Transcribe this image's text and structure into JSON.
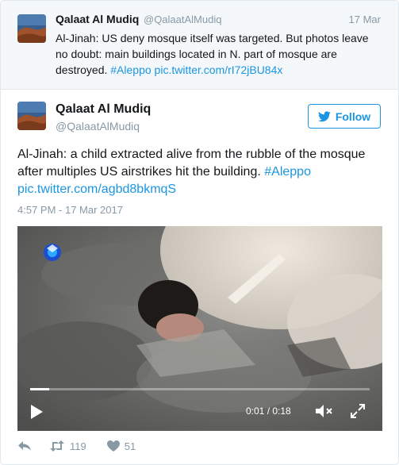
{
  "parent_tweet": {
    "display_name": "Qalaat Al Mudiq",
    "handle": "@QalaatAlMudiq",
    "date": "17 Mar",
    "text_plain": "Al-Jinah: US deny mosque itself was targeted. But photos leave no doubt: main buildings located in N. part of mosque are destroyed. ",
    "hashtag": "#Aleppo",
    "pic_link": "pic.twitter.com/rI72jBU84x"
  },
  "tweet": {
    "display_name": "Qalaat Al Mudiq",
    "handle": "@QalaatAlMudiq",
    "follow_label": "Follow",
    "text_plain": "Al-Jinah: a child extracted alive from the rubble of the mosque after multiples US airstrikes hit the building. ",
    "hashtag": "#Aleppo",
    "pic_link": "pic.twitter.com/agbd8bkmqS",
    "timestamp": "4:57 PM - 17 Mar 2017"
  },
  "video": {
    "time_display": "0:01 / 0:18",
    "progress_fraction": 0.055,
    "icons": [
      "play-icon",
      "mute-icon",
      "fullscreen-icon"
    ]
  },
  "actions": {
    "retweet_count": "119",
    "like_count": "51"
  },
  "colors": {
    "link": "#1b95e0",
    "secondary_text": "#8899a6",
    "parent_background": "#f5f8fa"
  }
}
